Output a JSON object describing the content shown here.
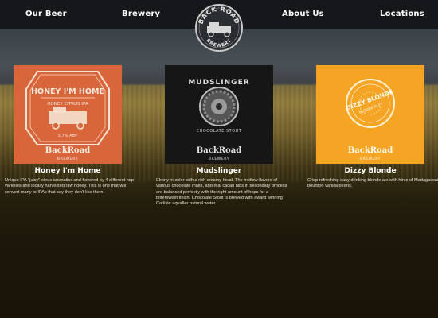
{
  "nav": {
    "items": [
      {
        "label": "Our Beer"
      },
      {
        "label": "Brewery"
      },
      {
        "label": "About Us"
      },
      {
        "label": "Locations"
      }
    ],
    "logo": {
      "top_text": "BACK ROAD",
      "bottom_text": "BREWERY"
    }
  },
  "beers": [
    {
      "name": "Honey I'm Home",
      "label_lines": [
        "HONEY I'M HOME",
        "HONEY CITRUS IPA",
        "5.7% ABV"
      ],
      "brand": "BackRoad",
      "brand_sub": "BREWERY",
      "description": "Unique IPA \"juicy\" citrus aromatics and flavored by 4 different hop varieties and locally harvested raw honey. This is one that will convert many to IPAs that say they don't like them.",
      "color": "#d9653a"
    },
    {
      "name": "Mudslinger",
      "label_lines": [
        "MUDSLINGER",
        "CHOCOLATE STOUT"
      ],
      "brand": "BackRoad",
      "brand_sub": "BREWERY",
      "description": "Ebony in color with a rich creamy head. The mellow flavors of various chocolate malts, and real cacao nibs in secondary process are balanced perfectly with the right amount of hops for a bittersweet finish. Chocolate Stout is brewed with award winning Carlisle aquafier natural water.",
      "color": "#161616"
    },
    {
      "name": "Dizzy Blonde",
      "label_lines": [
        "DIZZY BLONDE",
        "BLONDE ALE"
      ],
      "brand": "BackRoad",
      "brand_sub": "BREWERY",
      "description": "Crisp refreshing easy drinking blonde ale with hints of Madagascar bourbon vanilla beans.",
      "color": "#f5a523"
    }
  ]
}
